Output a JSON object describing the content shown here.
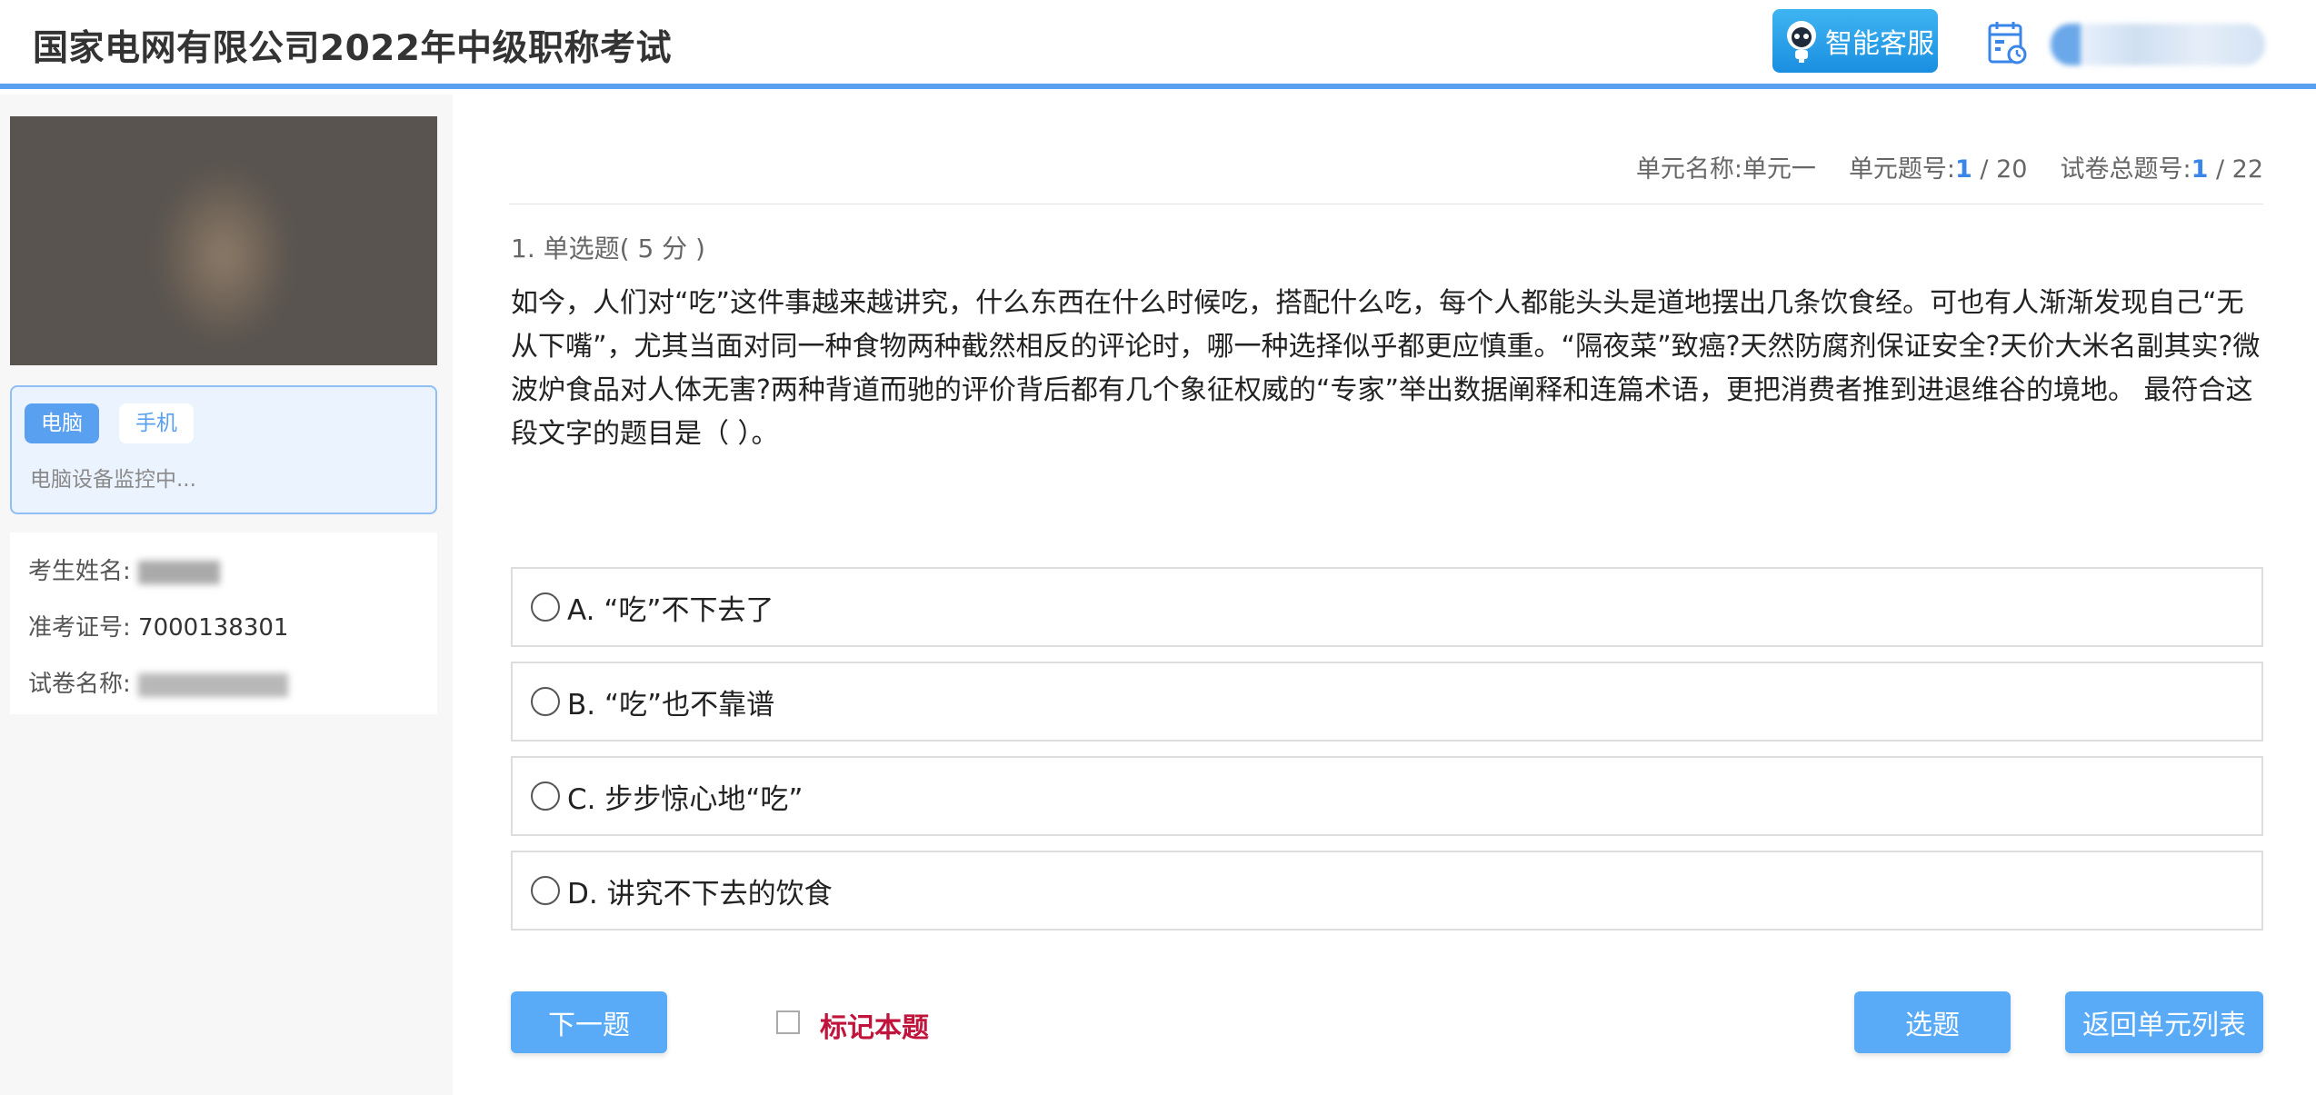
{
  "header": {
    "title": "国家电网有限公司2022年中级职称考试",
    "service_label": "智能客服"
  },
  "sidebar": {
    "tabs": [
      "电脑",
      "手机"
    ],
    "monitor_status": "电脑设备监控中...",
    "info": {
      "name_label": "考生姓名:",
      "id_label": "准考证号:",
      "id_value": "7000138301",
      "paper_label": "试卷名称:"
    }
  },
  "meta": {
    "unit_name_label": "单元名称:",
    "unit_name": "单元一",
    "unit_no_label": "单元题号:",
    "unit_current": "1",
    "unit_total": " / 20",
    "paper_no_label": "试卷总题号:",
    "paper_current": "1",
    "paper_total": " / 22"
  },
  "question": {
    "type_label": "1. 单选题( 5 分 )",
    "text": "如今，人们对“吃”这件事越来越讲究，什么东西在什么时候吃，搭配什么吃，每个人都能头头是道地摆出几条饮食经。可也有人渐渐发现自己“无从下嘴”，尤其当面对同一种食物两种截然相反的评论时，哪一种选择似乎都更应慎重。“隔夜菜”致癌?天然防腐剂保证安全?天价大米名副其实?微波炉食品对人体无害?两种背道而驰的评价背后都有几个象征权威的“专家”举出数据阐释和连篇术语，更把消费者推到进退维谷的境地。 最符合这段文字的题目是（ ）。",
    "options": [
      "A. “吃”不下去了",
      "B. “吃”也不靠谱",
      "C. 步步惊心地“吃”",
      "D. 讲究不下去的饮食"
    ]
  },
  "actions": {
    "next": "下一题",
    "mark": "标记本题",
    "choose": "选题",
    "back": "返回单元列表"
  },
  "colors": {
    "accent": "#5aa0f0",
    "button": "#5aabf7",
    "mark": "#c0143c"
  }
}
